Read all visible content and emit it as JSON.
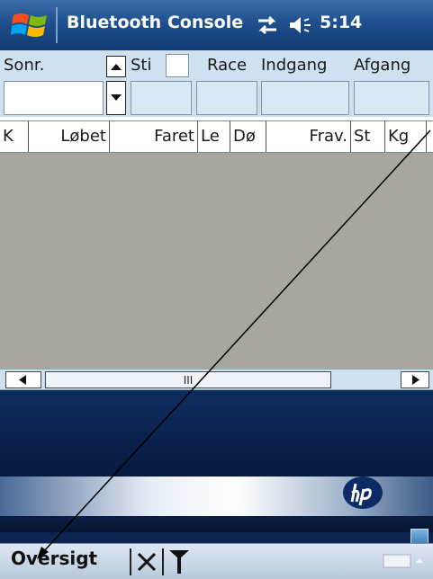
{
  "titlebar": {
    "title": "Bluetooth Console",
    "clock": "5:14"
  },
  "form": {
    "sonr_label": "Sonr.",
    "sti_label": "Sti",
    "race_label": "Race",
    "indgang_label": "Indgang",
    "afgang_label": "Afgang"
  },
  "grid": {
    "columns": [
      "K",
      "Løbet",
      "Faret",
      "Le",
      "Dø",
      "Frav.",
      "St",
      "Kg"
    ]
  },
  "scrollbar": {
    "thumb_label": "III"
  },
  "softbar": {
    "left_label": "Oversigt"
  },
  "colors": {
    "title_bg": "#1f4f8e",
    "form_bg": "#cfe0f1",
    "grid_bg": "#a7a7a0"
  }
}
